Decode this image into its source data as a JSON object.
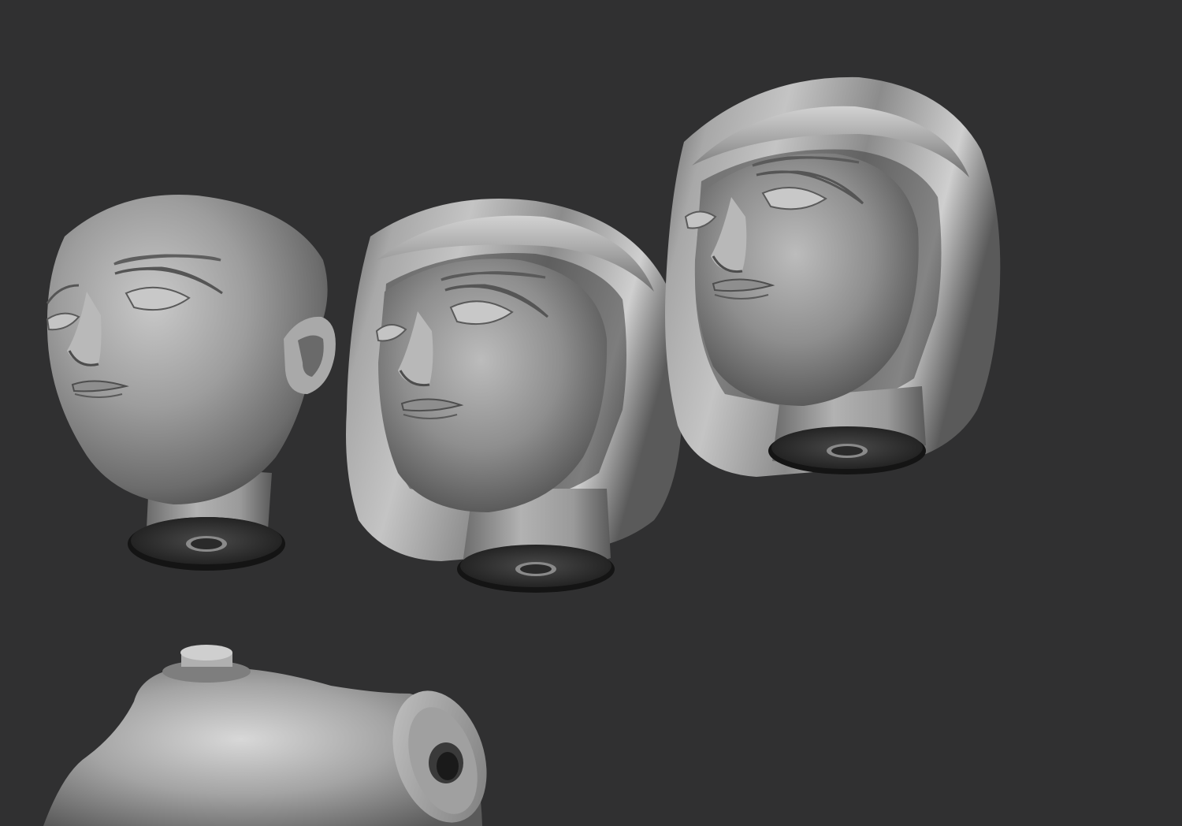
{
  "viewport": {
    "background_color": "#303031",
    "material_color": "#9a9a9a"
  },
  "models": [
    {
      "name": "bald-head",
      "description_icon": "bald-head-sculpt"
    },
    {
      "name": "wig-head",
      "description_icon": "wig-head-sculpt"
    },
    {
      "name": "wig-head-tilted",
      "description_icon": "wig-head-tilted-sculpt"
    },
    {
      "name": "torso",
      "description_icon": "torso-sculpt"
    }
  ]
}
